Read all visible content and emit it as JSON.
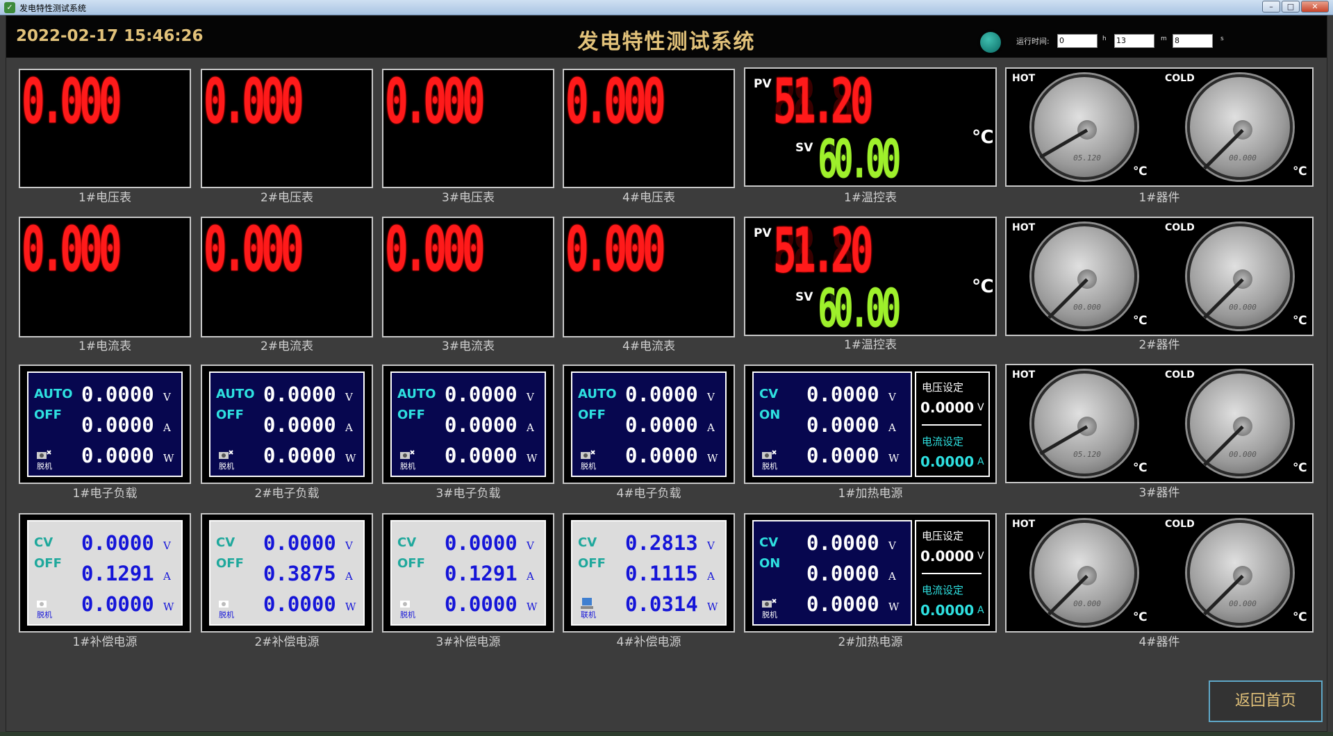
{
  "window": {
    "title": "发电特性测试系统",
    "min": "–",
    "max": "□",
    "close": "✕"
  },
  "header": {
    "datetime": "2022-02-17 15:46:26",
    "title": "发电特性测试系统",
    "runtime_label": "运行时间:",
    "hours": "0",
    "h_unit": "h",
    "minutes": "13",
    "m_unit": "m",
    "seconds": "8",
    "s_unit": "s"
  },
  "meters": {
    "voltage": [
      {
        "label": "1#电压表",
        "value": "0.000"
      },
      {
        "label": "2#电压表",
        "value": "0.000"
      },
      {
        "label": "3#电压表",
        "value": "0.000"
      },
      {
        "label": "4#电压表",
        "value": "0.000"
      }
    ],
    "current": [
      {
        "label": "1#电流表",
        "value": "0.000"
      },
      {
        "label": "2#电流表",
        "value": "0.000"
      },
      {
        "label": "3#电流表",
        "value": "0.000"
      },
      {
        "label": "4#电流表",
        "value": "0.000"
      }
    ]
  },
  "temp_controllers": [
    {
      "label": "1#温控表",
      "pv_tag": "PV",
      "pv": "51.20",
      "sv_tag": "SV",
      "sv": "60.00",
      "unit": "℃"
    },
    {
      "label": "1#温控表",
      "pv_tag": "PV",
      "pv": "51.20",
      "sv_tag": "SV",
      "sv": "60.00",
      "unit": "℃"
    }
  ],
  "devices": [
    {
      "label": "1#器件",
      "hot": "HOT",
      "cold": "COLD",
      "hot_read": "05.120",
      "cold_read": "00.000",
      "unit": "℃"
    },
    {
      "label": "2#器件",
      "hot": "HOT",
      "cold": "COLD",
      "hot_read": "00.000",
      "cold_read": "00.000",
      "unit": "℃"
    },
    {
      "label": "3#器件",
      "hot": "HOT",
      "cold": "COLD",
      "hot_read": "05.120",
      "cold_read": "00.000",
      "unit": "℃"
    },
    {
      "label": "4#器件",
      "hot": "HOT",
      "cold": "COLD",
      "hot_read": "00.000",
      "cold_read": "00.000",
      "unit": "℃"
    }
  ],
  "eloads": [
    {
      "label": "1#电子负载",
      "mode": "AUTO",
      "state": "OFF",
      "v": "0.0000",
      "a": "0.0000",
      "w": "0.0000",
      "machine": "脱机"
    },
    {
      "label": "2#电子负载",
      "mode": "AUTO",
      "state": "OFF",
      "v": "0.0000",
      "a": "0.0000",
      "w": "0.0000",
      "machine": "脱机"
    },
    {
      "label": "3#电子负载",
      "mode": "AUTO",
      "state": "OFF",
      "v": "0.0000",
      "a": "0.0000",
      "w": "0.0000",
      "machine": "脱机"
    },
    {
      "label": "4#电子负载",
      "mode": "AUTO",
      "state": "OFF",
      "v": "0.0000",
      "a": "0.0000",
      "w": "0.0000",
      "machine": "脱机"
    }
  ],
  "comp_supplies": [
    {
      "label": "1#补偿电源",
      "mode": "CV",
      "state": "OFF",
      "v": "0.0000",
      "a": "0.1291",
      "w": "0.0000",
      "machine": "脱机"
    },
    {
      "label": "2#补偿电源",
      "mode": "CV",
      "state": "OFF",
      "v": "0.0000",
      "a": "0.3875",
      "w": "0.0000",
      "machine": "脱机"
    },
    {
      "label": "3#补偿电源",
      "mode": "CV",
      "state": "OFF",
      "v": "0.0000",
      "a": "0.1291",
      "w": "0.0000",
      "machine": "脱机"
    },
    {
      "label": "4#补偿电源",
      "mode": "CV",
      "state": "OFF",
      "v": "0.2813",
      "a": "0.1115",
      "w": "0.0314",
      "machine": "联机"
    }
  ],
  "heat_supplies": [
    {
      "label": "1#加热电源",
      "mode": "CV",
      "state": "ON",
      "v": "0.0000",
      "a": "0.0000",
      "w": "0.0000",
      "machine": "脱机",
      "vset_label": "电压设定",
      "vset": "0.0000",
      "iset_label": "电流设定",
      "iset": "0.0000"
    },
    {
      "label": "2#加热电源",
      "mode": "CV",
      "state": "ON",
      "v": "0.0000",
      "a": "0.0000",
      "w": "0.0000",
      "machine": "脱机",
      "vset_label": "电压设定",
      "vset": "0.0000",
      "iset_label": "电流设定",
      "iset": "0.0000"
    }
  ],
  "units": {
    "v": "V",
    "a": "A",
    "w": "W"
  },
  "back_button": "返回首页",
  "colors": {
    "seg_red": "#ff1a1a",
    "seg_green": "#9ef02b",
    "panel_blue": "#07074f",
    "gold": "#e2c27a",
    "cyan": "#2ee0e0"
  }
}
